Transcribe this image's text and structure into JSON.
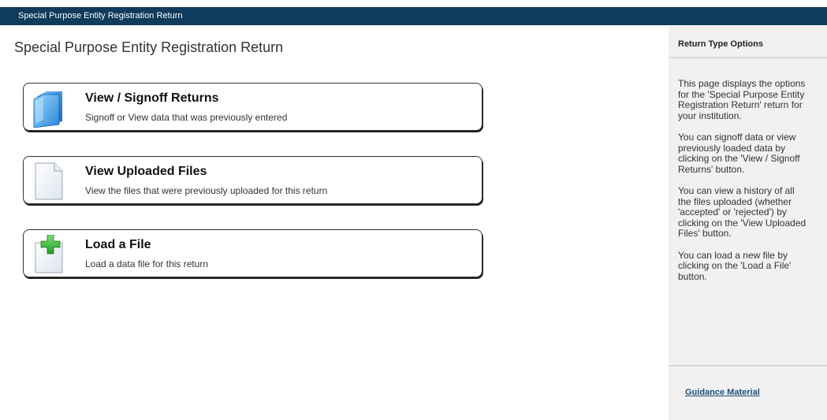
{
  "header": {
    "title": "Special Purpose Entity Registration Return"
  },
  "main": {
    "page_title": "Special Purpose Entity Registration Return",
    "options": [
      {
        "icon": "folder-icon",
        "title": "View / Signoff Returns",
        "description": "Signoff or View data that was previously entered"
      },
      {
        "icon": "document-icon",
        "title": "View Uploaded Files",
        "description": "View the files that were previously uploaded for this return"
      },
      {
        "icon": "add-file-icon",
        "title": "Load a File",
        "description": "Load a data file for this return"
      }
    ]
  },
  "sidebar": {
    "heading": "Return Type Options",
    "paragraphs": [
      "This page displays the options\nfor the 'Special Purpose Entity\nRegistration Return' return for\nyour institution.",
      "You can signoff data or view\npreviously loaded data by\nclicking on the 'View / Signoff\nReturns' button.",
      "You can view a history of all\nthe files uploaded (whether\n'accepted' or 'rejected') by\nclicking on the 'View Uploaded\nFiles' button.",
      "You can load a new file by\nclicking on the 'Load a File'\nbutton."
    ],
    "link_label": "Guidance Material"
  },
  "colors": {
    "header_bg": "#0f3b5c",
    "sidebar_bg": "#f1f1f1",
    "link": "#1a4f7a",
    "folder_blue": "#2a86d8",
    "plus_green": "#3cc43c"
  }
}
